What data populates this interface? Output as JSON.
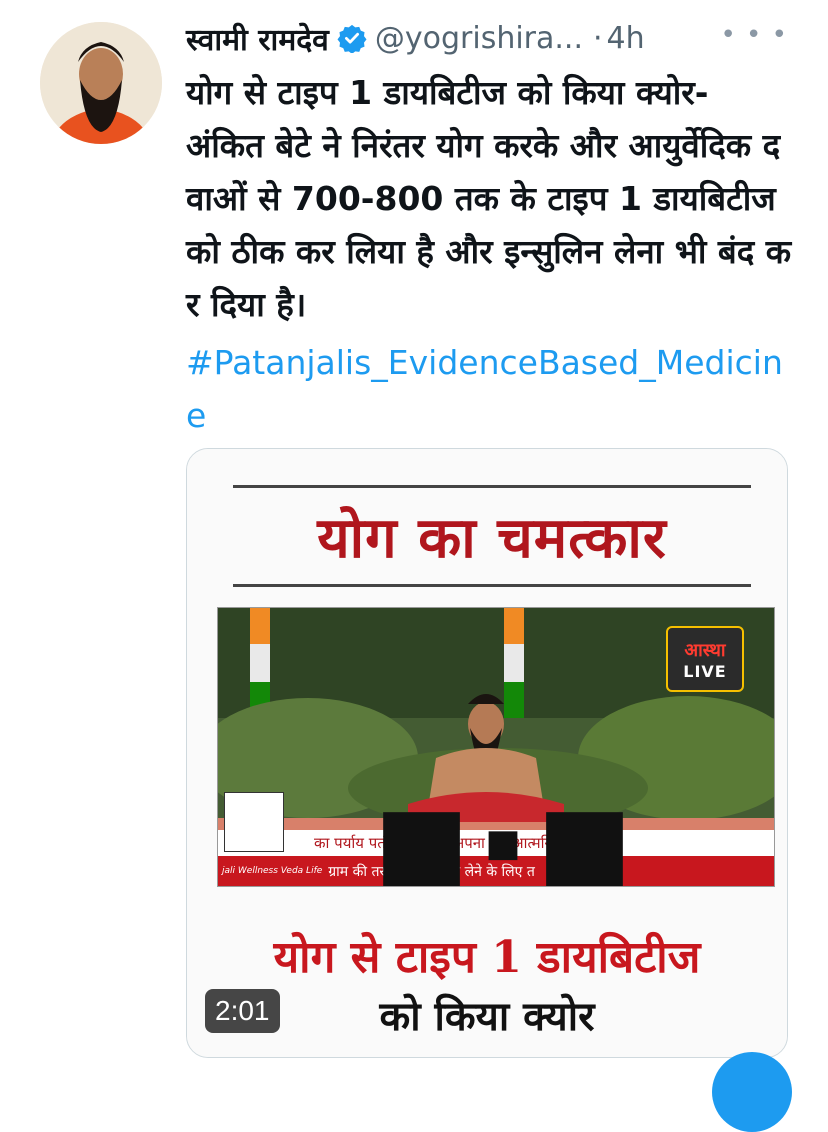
{
  "tweet": {
    "author_name": "स्वामी रामदेव",
    "handle": "@yogrishira...",
    "separator": "·",
    "time": "4h",
    "more_icon": "more-horizontal-icon",
    "verified_icon": "verified-badge-icon",
    "text": "योग से टाइप 1 डायबिटीज को किया क्योर- अंकित बेटे ने निरंतर योग करके और आयुर्वेदिक दवाओं से 700-800 तक के टाइप 1 डायबिटीज को ठीक कर लिया है और इन्सुलिन लेना भी बंद कर दिया है।",
    "hashtag": "#Patanjalis_EvidenceBased_Medicine"
  },
  "media": {
    "banner": "योग का चमत्कार",
    "channel": "आस्था",
    "live": "LIVE",
    "ticker_top": "का पर्याय पतंजलि उत्पाद अपना कर आत्मनिर्भर",
    "ticker_brand": "jali Wellness Veda Life",
    "ticker_bottom": "ग्राम की तरह आरोग्य लाभ लेने के लिए त",
    "caption_line1": "योग से टाइप 1 डायबिटीज",
    "caption_line2": "को किया क्योर",
    "duration": "2:01"
  },
  "colors": {
    "link": "#1d9bf0",
    "secondary_text": "#536471",
    "banner_red": "#b0161d"
  }
}
